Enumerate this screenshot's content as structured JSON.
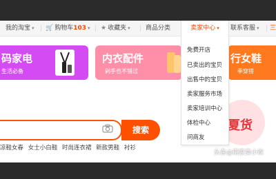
{
  "topnav": {
    "my_taobao": "我的淘宝",
    "cart_label": "购物车",
    "cart_count": "103",
    "favorites": "收藏夹",
    "categories": "商品分类",
    "seller_center": "卖家中心",
    "contact": "联系客服",
    "more": "三"
  },
  "seller_dropdown": [
    "免费开店",
    "已卖出的宝贝",
    "出售中的宝贝",
    "卖家服务市场",
    "卖家培训中心",
    "体检中心",
    "问商友"
  ],
  "banners": [
    {
      "title": "码家电",
      "subtitle": "生活必备"
    },
    {
      "title": "内衣配件",
      "subtitle": "剁手也不错过"
    },
    {
      "title": "行女鞋",
      "subtitle": "季穿搭"
    }
  ],
  "search": {
    "button_label": "搜索",
    "hot_words": [
      "凉鞋女春",
      "女士小白鞋",
      "时尚连衣裙",
      "新款男鞋",
      "衬衫"
    ]
  },
  "promo": {
    "text": "夏货"
  },
  "watermark": "头条@南家卖小欢",
  "colors": {
    "accent": "#ff5000",
    "seller_text": "#ff4400",
    "banner_purple": "#d44af3",
    "banner_pink": "#ff8fa9",
    "banner_orange": "#ff7a1f"
  }
}
